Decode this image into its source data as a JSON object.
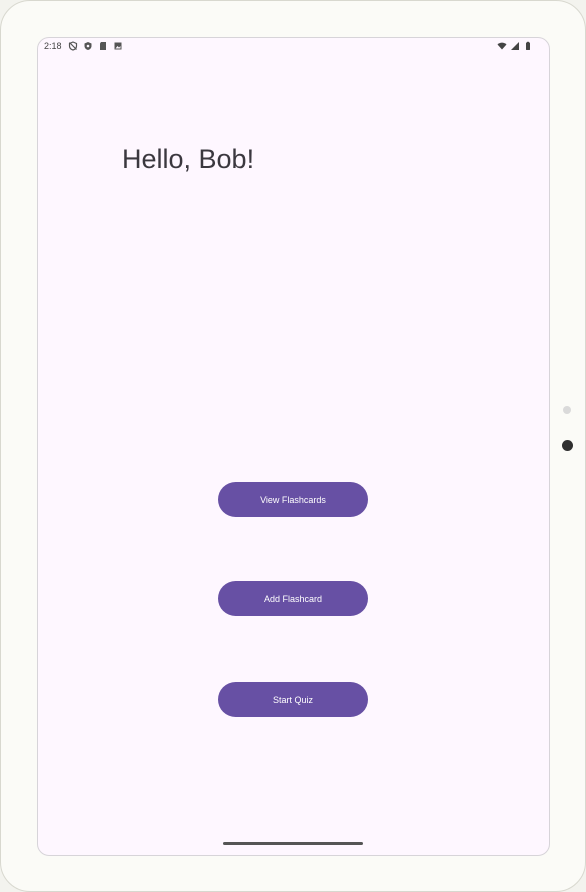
{
  "status_bar": {
    "time": "2:18",
    "left_icons": [
      "shield-off-icon",
      "shield-icon",
      "sd-card-icon",
      "photo-icon"
    ],
    "right_icons": [
      "wifi-icon",
      "signal-icon",
      "battery-icon"
    ]
  },
  "main": {
    "greeting": "Hello, Bob!",
    "buttons": {
      "view_flashcards": "View Flashcards",
      "add_flashcard": "Add Flashcard",
      "start_quiz": "Start Quiz"
    }
  },
  "colors": {
    "primary": "#6750a4",
    "background": "#fef7ff",
    "on_primary": "#ffffff",
    "text": "#3b383f"
  }
}
